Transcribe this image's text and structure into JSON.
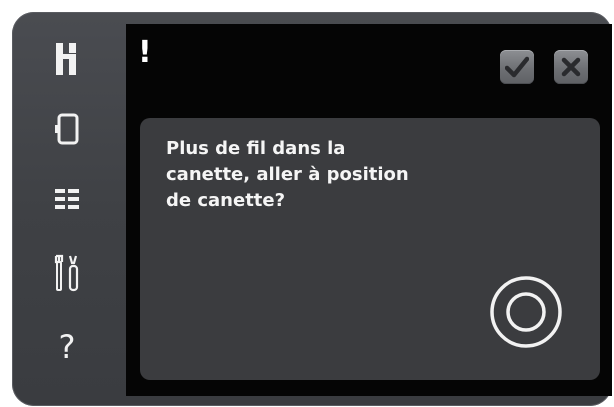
{
  "sidebar": {
    "items": [
      {
        "name": "presser-foot-icon"
      },
      {
        "name": "screen-icon"
      },
      {
        "name": "menu-list-icon"
      },
      {
        "name": "settings-tools-icon"
      },
      {
        "name": "help-icon",
        "label": "?"
      }
    ]
  },
  "header": {
    "alert": "!",
    "confirm_icon": "check-icon",
    "cancel_icon": "close-icon"
  },
  "dialog": {
    "message": "Plus de fil dans la\ncanette, aller à position\nde canette?",
    "action_icon": "bobbin-position-icon"
  },
  "colors": {
    "bezel": "#404246",
    "screen": "#050505",
    "panel": "#3b3c3f",
    "button": "#7a7c80",
    "text": "#f5f5f5"
  }
}
